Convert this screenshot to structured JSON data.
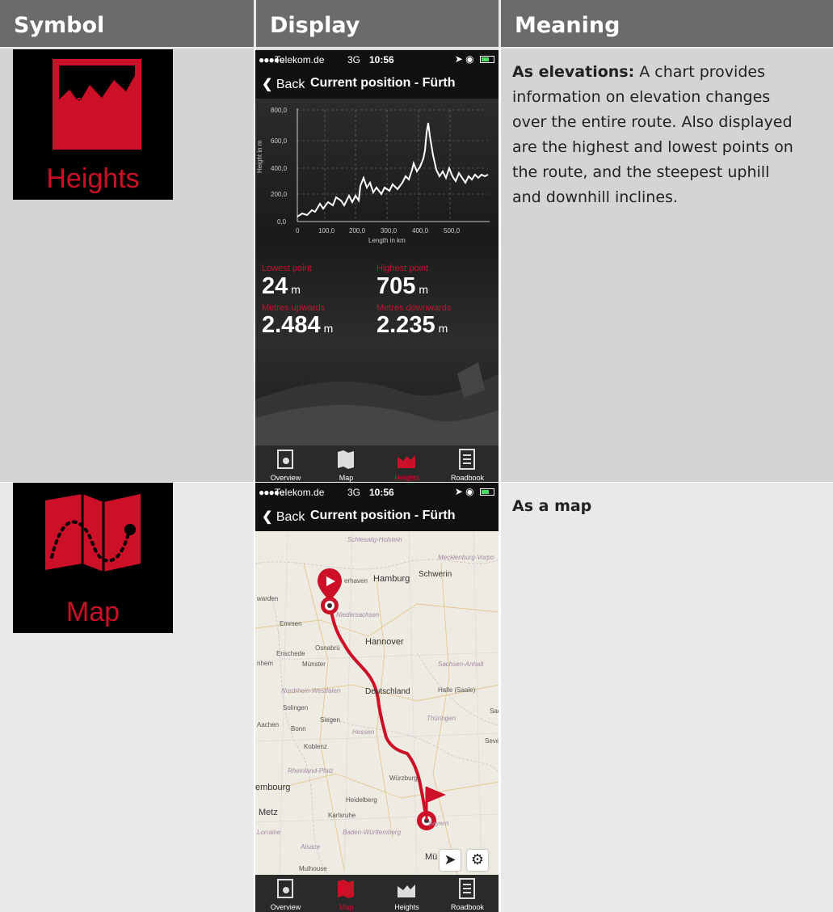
{
  "headers": {
    "symbol": "Symbol",
    "display": "Display",
    "meaning": "Meaning"
  },
  "rows": [
    {
      "symbol_label": "Heights",
      "symbol_icon": "heights-icon",
      "meaning_bold": "As elevations:",
      "meaning_text": " A chart provides information on elevation changes over the entire route. Also displayed are the highest and lowest points on the route, and the steepest uphill and downhill inclines.",
      "phone": {
        "status": {
          "dots": "●●●●○",
          "carrier": "Telekom.de",
          "network": "3G",
          "time": "10:56"
        },
        "nav": {
          "back": "Back",
          "title": "Current position - Fürth"
        },
        "chart": {
          "ylabel": "Height in m",
          "xlabel": "Length in km",
          "yticks": [
            "800,0",
            "600,0",
            "400,0",
            "200,0",
            "0,0"
          ],
          "xticks": [
            "0",
            "100,0",
            "200,0",
            "300,0",
            "400,0",
            "500,0"
          ]
        },
        "stats": {
          "lowest_label": "Lowest point",
          "lowest_value": "24",
          "lowest_unit": "m",
          "highest_label": "Highest point",
          "highest_value": "705",
          "highest_unit": "m",
          "up_label": "Metres upwards",
          "up_value": "2.484",
          "up_unit": "m",
          "down_label": "Metres downwards",
          "down_value": "2.235",
          "down_unit": "m"
        },
        "tabs": [
          "Overview",
          "Map",
          "Heights",
          "Roadbook"
        ],
        "active_tab": "Heights"
      }
    },
    {
      "symbol_label": "Map",
      "symbol_icon": "map-icon",
      "meaning_bold": "As a map",
      "phone": {
        "status": {
          "dots": "●●●●○",
          "carrier": "Telekom.de",
          "network": "3G",
          "time": "10:56"
        },
        "nav": {
          "back": "Back",
          "title": "Current position - Fürth"
        },
        "map_labels": {
          "schleswig": "Schleswig-Holstein",
          "mecklenburg": "Mecklenburg-Vorpo",
          "bremerhaven": "erhaven",
          "hamburg": "Hamburg",
          "schwerin": "Schwerin",
          "warden": "warden",
          "emmen": "Emmen",
          "niedersachsen": "Niedersachsen",
          "hannover": "Hannover",
          "enschede": "Enschede",
          "osnabrueck": "Osnabrü",
          "nhem": "nhem",
          "muenster": "Münster",
          "sachsen_anhalt": "Sachsen-Anhalt",
          "nrw": "Nordrhein-Westfalen",
          "deutschland": "Deutschland",
          "halle": "Halle (Saale)",
          "solingen": "Solingen",
          "thueringen": "Thüringen",
          "siegen": "Siegen",
          "aachen": "Aachen",
          "bonn": "Bonn",
          "hessen": "Hessen",
          "sac": "Sac",
          "koblenz": "Koblenz",
          "seve": "Seve",
          "rheinland": "Rheinland-Pfalz",
          "wuerzburg": "Würzburg",
          "luxembourg": "embourg",
          "heidelberg": "Heidelberg",
          "metz": "Metz",
          "karlsruhe": "Karlsruhe",
          "lorraine": "Lorraine",
          "bayern": "Bayern",
          "bw": "Baden-Württemberg",
          "alsace": "Alsace",
          "muenchen": "Mü",
          "mulhouse": "Mulhouse"
        },
        "tabs": [
          "Overview",
          "Map",
          "Heights",
          "Roadbook"
        ],
        "active_tab": "Map"
      }
    }
  ],
  "colors": {
    "brand_red": "#cc1028",
    "header_bg": "#6b6b6b",
    "row1_bg": "#d4d4d4",
    "row2_bg": "#e9e9e9"
  }
}
